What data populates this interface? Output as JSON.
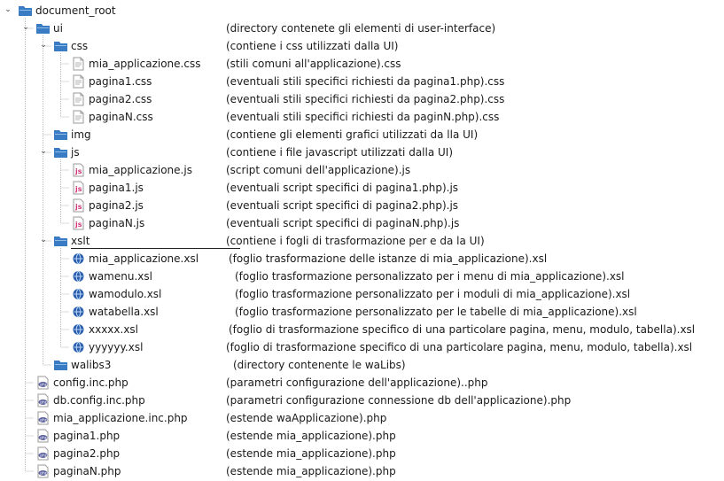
{
  "tree": {
    "rows": [
      {
        "level": 0,
        "icon": "folder-icon",
        "expanded": true,
        "name": "document_root",
        "desc": ""
      },
      {
        "level": 1,
        "icon": "folder-icon",
        "expanded": true,
        "name": "ui",
        "desc": "(directory contenete gli elementi di user-interface)"
      },
      {
        "level": 2,
        "icon": "folder-icon",
        "expanded": true,
        "name": "css",
        "desc": "(contiene i css utilizzati dalla UI)"
      },
      {
        "level": 3,
        "icon": "css-file-icon",
        "name": "mia_applicazione.css",
        "desc": "(stili comuni all'applicazione).css"
      },
      {
        "level": 3,
        "icon": "css-file-icon",
        "name": "pagina1.css",
        "desc": "(eventuali stili specifici richiesti da pagina1.php).css"
      },
      {
        "level": 3,
        "icon": "css-file-icon",
        "name": "pagina2.css",
        "desc": "(eventuali stili specifici richiesti da pagina2.php).css"
      },
      {
        "level": 3,
        "icon": "css-file-icon",
        "name": "paginaN.css",
        "desc": "(eventuali stili specifici richiesti da paginN.php).css"
      },
      {
        "level": 2,
        "icon": "folder-icon",
        "name": "img",
        "desc": "(contiene gli elementi grafici utilizzati da lla UI)"
      },
      {
        "level": 2,
        "icon": "folder-icon",
        "expanded": true,
        "name": "js",
        "desc": "(contiene i file javascript utilizzati dalla UI)"
      },
      {
        "level": 3,
        "icon": "js-file-icon",
        "name": "mia_applicazione.js",
        "desc": "(script comuni dell'applicazione).js"
      },
      {
        "level": 3,
        "icon": "js-file-icon",
        "name": "pagina1.js",
        "desc": "(eventuali script specifici di pagina1.php).js"
      },
      {
        "level": 3,
        "icon": "js-file-icon",
        "name": "pagina2.js",
        "desc": "(eventuali script specifici di pagina2.php).js"
      },
      {
        "level": 3,
        "icon": "js-file-icon",
        "name": "paginaN.js",
        "desc": "(eventuali script specifici di paginaN.php).js"
      },
      {
        "level": 2,
        "icon": "folder-icon",
        "expanded": true,
        "selected": true,
        "name": "xslt",
        "desc": "(contiene i fogli di trasformazione per e da la UI)"
      },
      {
        "level": 3,
        "icon": "xsl-file-icon",
        "name": "mia_applicazione.xsl",
        "desc": "(foglio trasformazione delle istanze di mia_applicazione).xsl"
      },
      {
        "level": 3,
        "icon": "xsl-file-icon",
        "name": "wamenu.xsl",
        "desc": "(foglio trasformazione personalizzato per i menu di mia_applicazione).xsl"
      },
      {
        "level": 3,
        "icon": "xsl-file-icon",
        "name": "wamodulo.xsl",
        "desc": "(foglio trasformazione personalizzato per i moduli di mia_applicazione).xsl"
      },
      {
        "level": 3,
        "icon": "xsl-file-icon",
        "name": "watabella.xsl",
        "desc": "(foglio trasformazione personalizzato per le tabelle di mia_applicazione).xsl"
      },
      {
        "level": 3,
        "icon": "xsl-file-icon",
        "name": "xxxxx.xsl",
        "desc": "(foglio di trasformazione specifico di una particolare pagina, menu, modulo, tabella).xsl"
      },
      {
        "level": 3,
        "icon": "xsl-file-icon",
        "name": "yyyyyy.xsl",
        "desc": "(foglio di trasformazione specifico di una particolare pagina, menu, modulo, tabella).xsl"
      },
      {
        "level": 2,
        "icon": "folder-icon",
        "name": "walibs3",
        "desc": "(directory contenente le waLibs)"
      },
      {
        "level": 1,
        "icon": "php-file-icon",
        "name": "config.inc.php",
        "desc": "(parametri configurazione dell'applicazione)..php"
      },
      {
        "level": 1,
        "icon": "php-file-icon",
        "name": "db.config.inc.php",
        "desc": "(parametri configurazione connessione db dell'applicazione).php"
      },
      {
        "level": 1,
        "icon": "php-file-icon",
        "name": "mia_applicazione.inc.php",
        "desc": "(estende waApplicazione).php"
      },
      {
        "level": 1,
        "icon": "php-file-icon",
        "name": "pagina1.php",
        "desc": "(estende mia_applicazione).php"
      },
      {
        "level": 1,
        "icon": "php-file-icon",
        "name": "pagina2.php",
        "desc": "(estende mia_applicazione).php"
      },
      {
        "level": 1,
        "icon": "php-file-icon",
        "name": "paginaN.php",
        "desc": "(estende mia_applicazione).php"
      }
    ]
  },
  "colors": {
    "folder": "#3a7cc4",
    "folder_light": "#8fbde8",
    "js_accent": "#d0357a",
    "php_accent": "#5a5f9e",
    "xsl_accent": "#2a5fae"
  }
}
